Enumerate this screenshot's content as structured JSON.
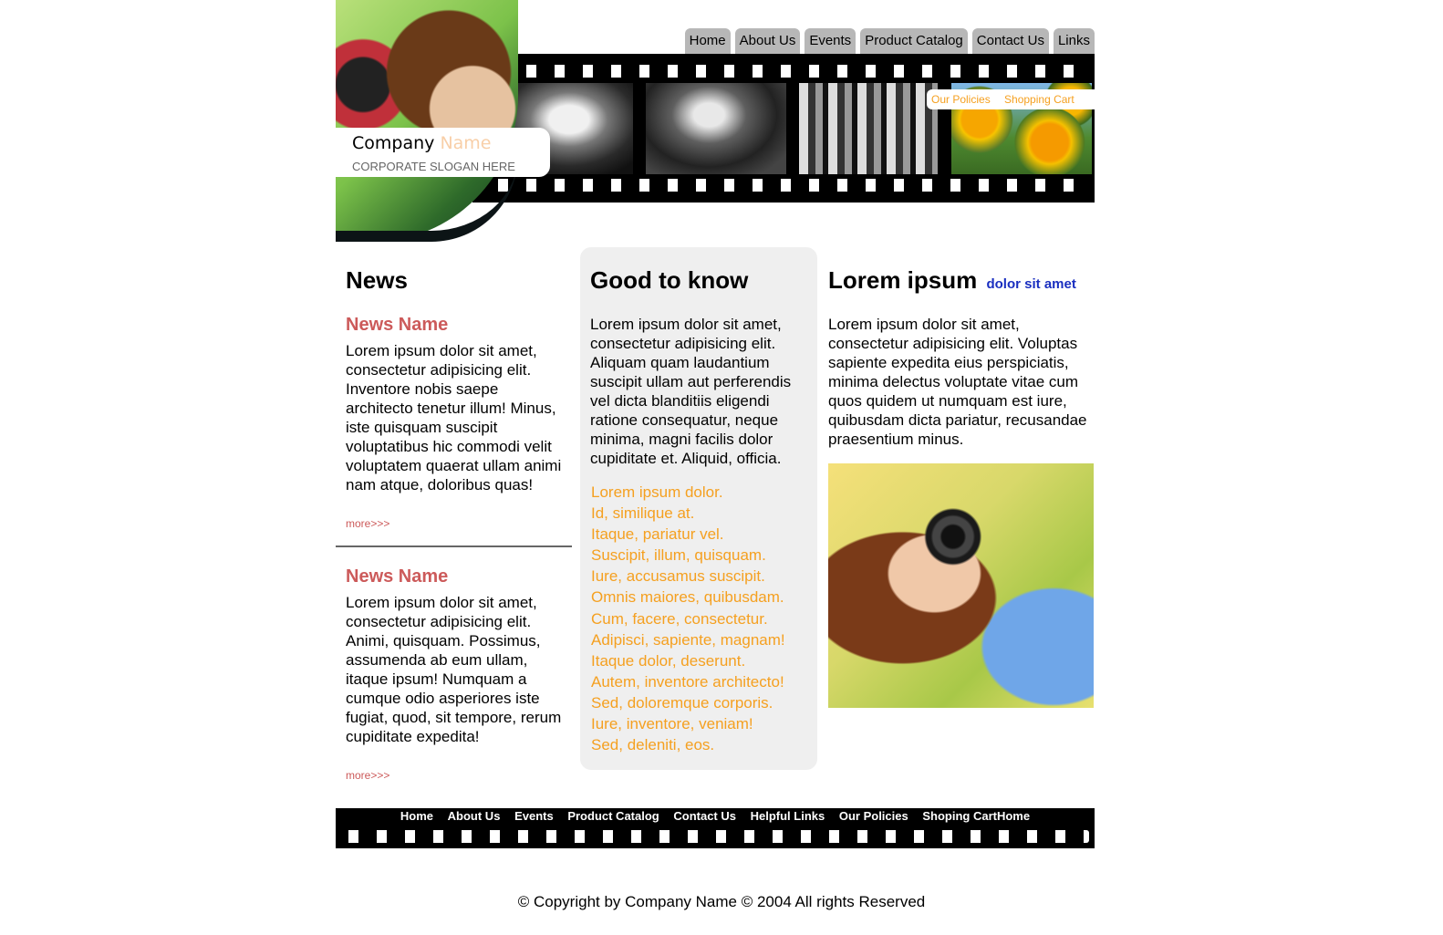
{
  "header": {
    "nav": [
      "Home",
      "About Us",
      "Events",
      "Product Catalog",
      "Contact Us",
      "Links"
    ],
    "sub_links": [
      "Our Policies",
      "Shopping Cart"
    ],
    "company_word": "Company",
    "name_word": "Name",
    "slogan": "CORPORATE SLOGAN HERE"
  },
  "news": {
    "heading": "News",
    "items": [
      {
        "title": "News Name",
        "text": "Lorem ipsum dolor sit amet, consectetur adipisicing elit. Inventore nobis saepe architecto tenetur illum! Minus, iste quisquam suscipit voluptatibus hic commodi velit voluptatem quaerat ullam animi nam atque, doloribus quas!",
        "more": "more>>>"
      },
      {
        "title": "News Name",
        "text": "Lorem ipsum dolor sit amet, consectetur adipisicing elit. Animi, quisquam. Possimus, assumenda ab eum ullam, itaque ipsum! Numquam a cumque odio asperiores iste fugiat, quod, sit tempore, rerum cupiditate expedita!",
        "more": "more>>>"
      }
    ]
  },
  "good_to_know": {
    "heading": "Good to know",
    "text": "Lorem ipsum dolor sit amet, consectetur adipisicing elit. Aliquam quam laudantium suscipit ullam aut perferendis vel dicta blanditiis eligendi ratione consequatur, neque minima, magni facilis dolor cupiditate et. Aliquid, officia.",
    "links": [
      "Lorem ipsum dolor.",
      "Id, similique at.",
      "Itaque, pariatur vel.",
      "Suscipit, illum, quisquam.",
      "Iure, accusamus suscipit.",
      "Omnis maiores, quibusdam.",
      "Cum, facere, consectetur.",
      "Adipisci, sapiente, magnam!",
      "Itaque dolor, deserunt.",
      "Autem, inventore architecto!",
      "Sed, doloremque corporis.",
      "Iure, inventore, veniam!",
      "Sed, deleniti, eos."
    ]
  },
  "lorem": {
    "heading": "Lorem ipsum",
    "sublink": "dolor sit amet",
    "text": "Lorem ipsum dolor sit amet, consectetur adipisicing elit. Voluptas sapiente expedita eius perspiciatis, minima delectus voluptate vitae cum quos quidem ut numquam est iure, quibusdam dicta pariatur, recusandae praesentium minus."
  },
  "footer": {
    "nav": [
      "Home",
      "About Us",
      "Events",
      "Product Catalog",
      "Contact Us",
      "Helpful Links",
      "Our Policies",
      "Shoping CartHome"
    ],
    "copyright": "© Copyright by Company Name © 2004 All rights Reserved"
  }
}
